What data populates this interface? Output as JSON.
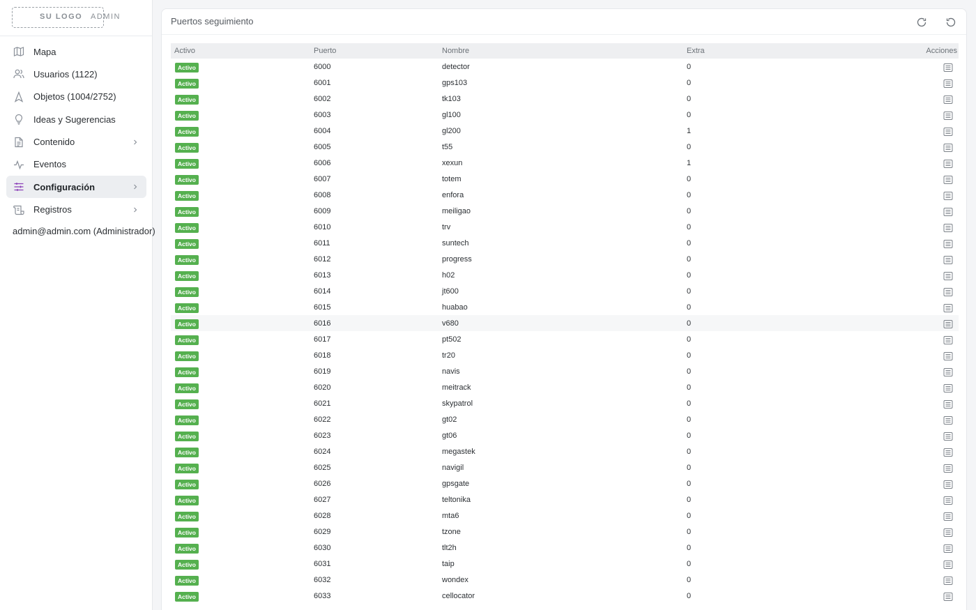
{
  "logo": {
    "text": "SU LOGO",
    "suffix": "ADMIN"
  },
  "sidebar": {
    "items": [
      {
        "label": "Mapa",
        "icon": "map-icon"
      },
      {
        "label": "Usuarios (1122)",
        "icon": "users-icon"
      },
      {
        "label": "Objetos (1004/2752)",
        "icon": "navigation-icon"
      },
      {
        "label": "Ideas y Sugerencias",
        "icon": "lightbulb-icon"
      },
      {
        "label": "Contenido",
        "icon": "document-icon",
        "has_children": true
      },
      {
        "label": "Eventos",
        "icon": "activity-icon"
      },
      {
        "label": "Configuración",
        "icon": "sliders-icon",
        "has_children": true,
        "active": true
      },
      {
        "label": "Registros",
        "icon": "scroll-icon",
        "has_children": true
      }
    ],
    "user": "admin@admin.com (Administrador)"
  },
  "panel": {
    "title": "Puertos seguimiento",
    "refresh_icon": "refresh-icon",
    "reset_icon": "reset-icon"
  },
  "table": {
    "headers": {
      "activo": "Activo",
      "puerto": "Puerto",
      "nombre": "Nombre",
      "extra": "Extra",
      "acciones": "Acciones"
    },
    "badge_label": "Activo",
    "badge_color": "#55b04f",
    "rows": [
      {
        "puerto": "6000",
        "nombre": "detector",
        "extra": "0"
      },
      {
        "puerto": "6001",
        "nombre": "gps103",
        "extra": "0"
      },
      {
        "puerto": "6002",
        "nombre": "tk103",
        "extra": "0"
      },
      {
        "puerto": "6003",
        "nombre": "gl100",
        "extra": "0"
      },
      {
        "puerto": "6004",
        "nombre": "gl200",
        "extra": "1"
      },
      {
        "puerto": "6005",
        "nombre": "t55",
        "extra": "0"
      },
      {
        "puerto": "6006",
        "nombre": "xexun",
        "extra": "1"
      },
      {
        "puerto": "6007",
        "nombre": "totem",
        "extra": "0"
      },
      {
        "puerto": "6008",
        "nombre": "enfora",
        "extra": "0"
      },
      {
        "puerto": "6009",
        "nombre": "meiligao",
        "extra": "0"
      },
      {
        "puerto": "6010",
        "nombre": "trv",
        "extra": "0"
      },
      {
        "puerto": "6011",
        "nombre": "suntech",
        "extra": "0"
      },
      {
        "puerto": "6012",
        "nombre": "progress",
        "extra": "0"
      },
      {
        "puerto": "6013",
        "nombre": "h02",
        "extra": "0"
      },
      {
        "puerto": "6014",
        "nombre": "jt600",
        "extra": "0"
      },
      {
        "puerto": "6015",
        "nombre": "huabao",
        "extra": "0"
      },
      {
        "puerto": "6016",
        "nombre": "v680",
        "extra": "0"
      },
      {
        "puerto": "6017",
        "nombre": "pt502",
        "extra": "0"
      },
      {
        "puerto": "6018",
        "nombre": "tr20",
        "extra": "0"
      },
      {
        "puerto": "6019",
        "nombre": "navis",
        "extra": "0"
      },
      {
        "puerto": "6020",
        "nombre": "meitrack",
        "extra": "0"
      },
      {
        "puerto": "6021",
        "nombre": "skypatrol",
        "extra": "0"
      },
      {
        "puerto": "6022",
        "nombre": "gt02",
        "extra": "0"
      },
      {
        "puerto": "6023",
        "nombre": "gt06",
        "extra": "0"
      },
      {
        "puerto": "6024",
        "nombre": "megastek",
        "extra": "0"
      },
      {
        "puerto": "6025",
        "nombre": "navigil",
        "extra": "0"
      },
      {
        "puerto": "6026",
        "nombre": "gpsgate",
        "extra": "0"
      },
      {
        "puerto": "6027",
        "nombre": "teltonika",
        "extra": "0"
      },
      {
        "puerto": "6028",
        "nombre": "mta6",
        "extra": "0"
      },
      {
        "puerto": "6029",
        "nombre": "tzone",
        "extra": "0"
      },
      {
        "puerto": "6030",
        "nombre": "tlt2h",
        "extra": "0"
      },
      {
        "puerto": "6031",
        "nombre": "taip",
        "extra": "0"
      },
      {
        "puerto": "6032",
        "nombre": "wondex",
        "extra": "0"
      },
      {
        "puerto": "6033",
        "nombre": "cellocator",
        "extra": "0"
      }
    ]
  }
}
